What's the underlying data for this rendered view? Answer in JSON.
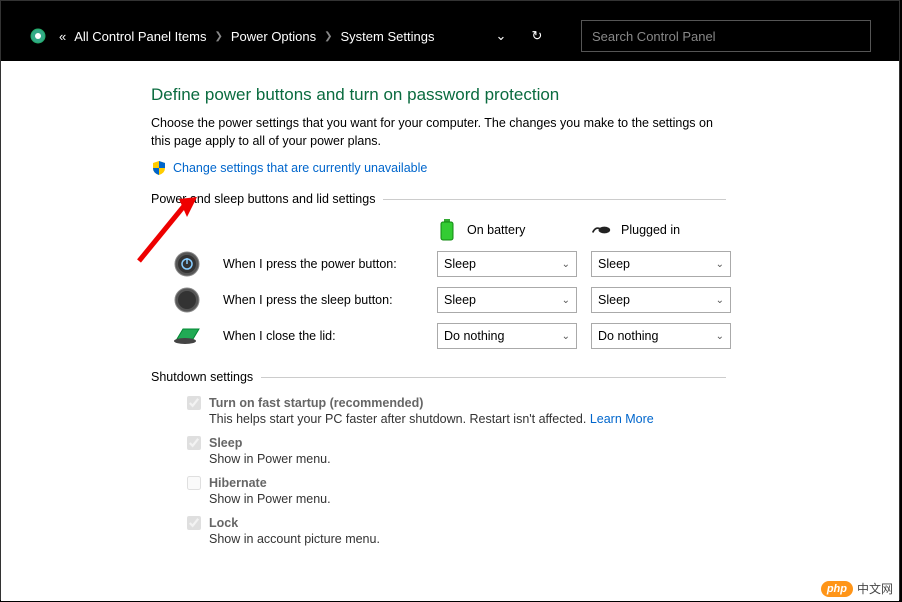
{
  "breadcrumb": {
    "prefix": "«",
    "items": [
      "All Control Panel Items",
      "Power Options",
      "System Settings"
    ]
  },
  "search": {
    "placeholder": "Search Control Panel"
  },
  "page": {
    "heading": "Define power buttons and turn on password protection",
    "description": "Choose the power settings that you want for your computer. The changes you make to the settings on this page apply to all of your power plans.",
    "change_link": "Change settings that are currently unavailable"
  },
  "sections": {
    "buttons_header": "Power and sleep buttons and lid settings",
    "shutdown_header": "Shutdown settings"
  },
  "columns": {
    "battery": "On battery",
    "plugged": "Plugged in"
  },
  "rows": {
    "power": {
      "label": "When I press the power button:",
      "battery": "Sleep",
      "plugged": "Sleep"
    },
    "sleep": {
      "label": "When I press the sleep button:",
      "battery": "Sleep",
      "plugged": "Sleep"
    },
    "lid": {
      "label": "When I close the lid:",
      "battery": "Do nothing",
      "plugged": "Do nothing"
    }
  },
  "shutdown": {
    "fast_startup": {
      "title": "Turn on fast startup (recommended)",
      "sub_prefix": "This helps start your PC faster after shutdown. Restart isn't affected. ",
      "learn": "Learn More",
      "checked": true
    },
    "sleep": {
      "title": "Sleep",
      "sub": "Show in Power menu.",
      "checked": true
    },
    "hibernate": {
      "title": "Hibernate",
      "sub": "Show in Power menu.",
      "checked": false
    },
    "lock": {
      "title": "Lock",
      "sub": "Show in account picture menu.",
      "checked": true
    }
  },
  "watermark": {
    "badge": "php",
    "text": "中文网"
  }
}
